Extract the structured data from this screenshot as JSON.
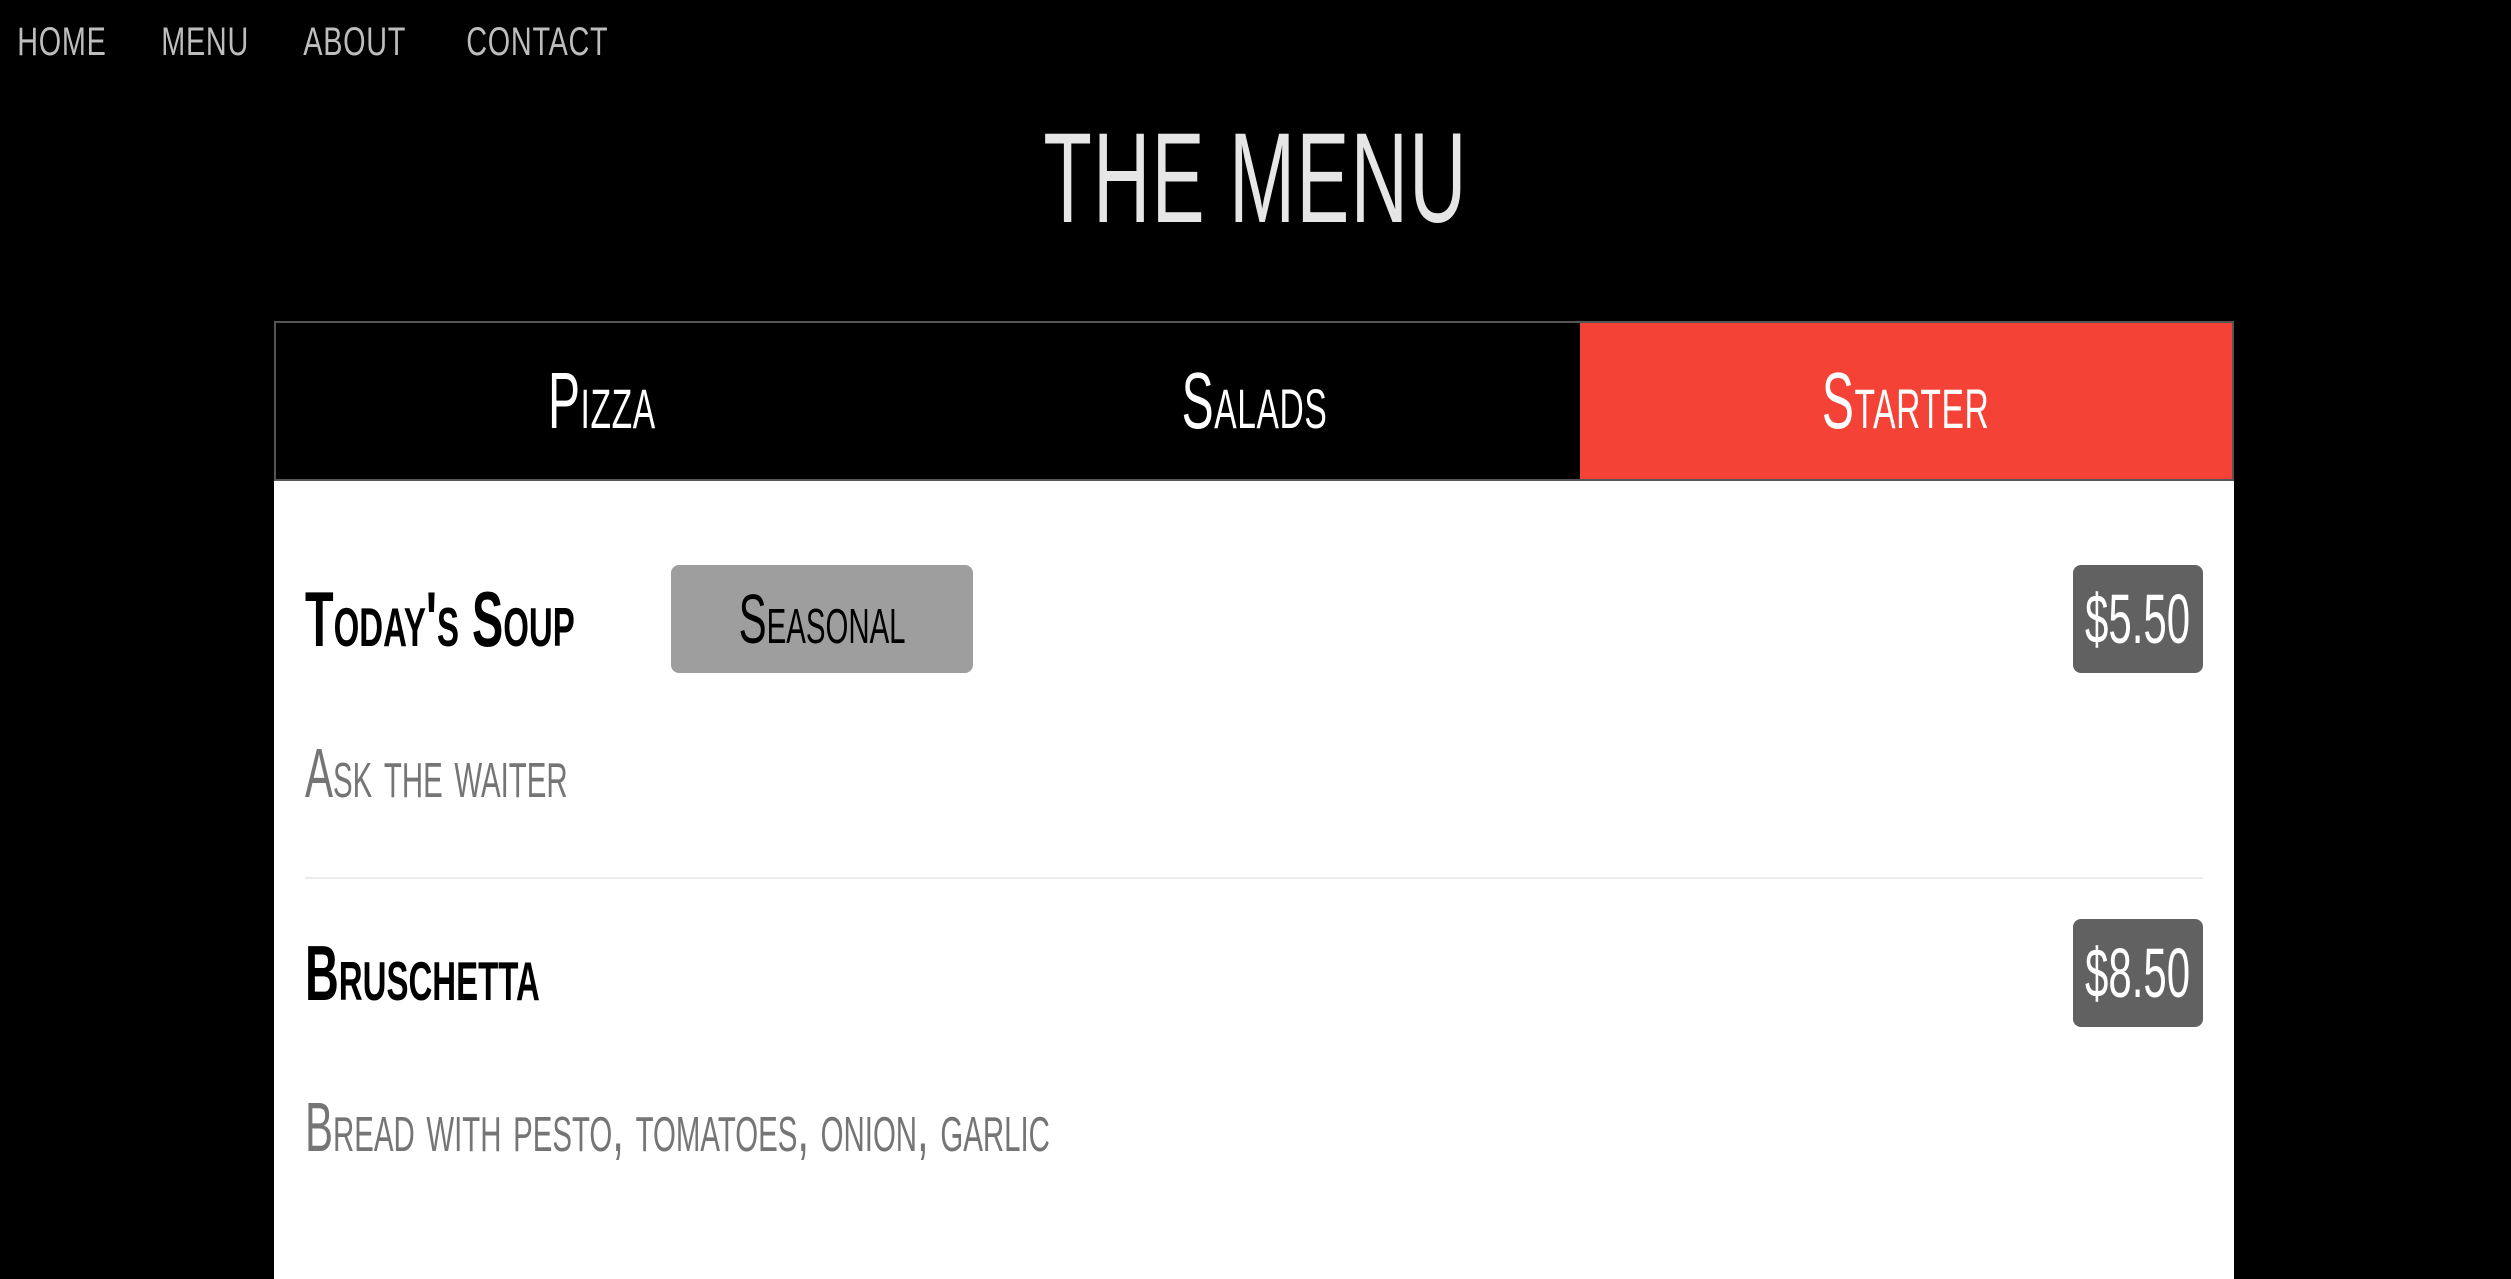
{
  "nav": {
    "items": [
      {
        "label": "HOME"
      },
      {
        "label": "MENU"
      },
      {
        "label": "ABOUT"
      },
      {
        "label": "CONTACT"
      }
    ]
  },
  "header": {
    "title": "THE MENU"
  },
  "tabs": [
    {
      "label": "Pizza",
      "active": false
    },
    {
      "label": "Salads",
      "active": false
    },
    {
      "label": "Starter",
      "active": true
    }
  ],
  "colors": {
    "accent": "#f44336",
    "tag_bg": "#9e9e9e",
    "price_bg": "#616161",
    "page_bg": "#000000"
  },
  "items": [
    {
      "name": "Today's Soup",
      "tag": "Seasonal",
      "price": "$5.50",
      "description": "Ask the waiter"
    },
    {
      "name": "Bruschetta",
      "price": "$8.50",
      "description": "Bread with pesto, tomatoes, onion, garlic"
    }
  ]
}
